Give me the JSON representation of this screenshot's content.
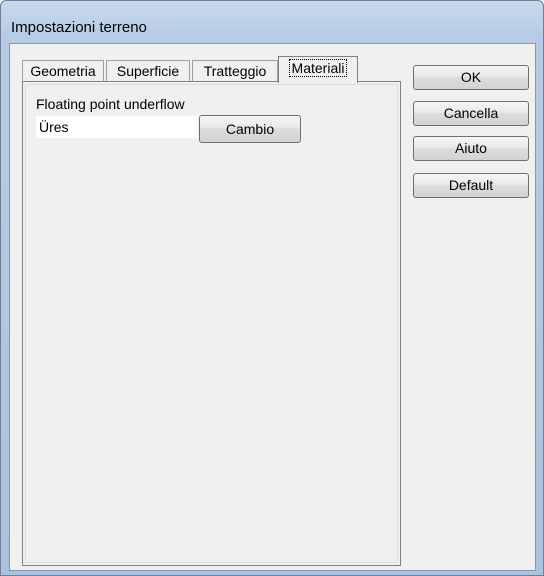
{
  "window": {
    "title": "Impostazioni terreno"
  },
  "tabs": [
    {
      "label": "Geometria",
      "active": false
    },
    {
      "label": "Superficie",
      "active": false
    },
    {
      "label": "Tratteggio",
      "active": false
    },
    {
      "label": "Materiali",
      "active": true
    }
  ],
  "materials_panel": {
    "field_label": "Floating point underflow",
    "field_value": "Üres",
    "change_button": "Cambio"
  },
  "buttons": {
    "ok": "OK",
    "cancel": "Cancella",
    "help": "Aiuto",
    "default": "Default"
  }
}
